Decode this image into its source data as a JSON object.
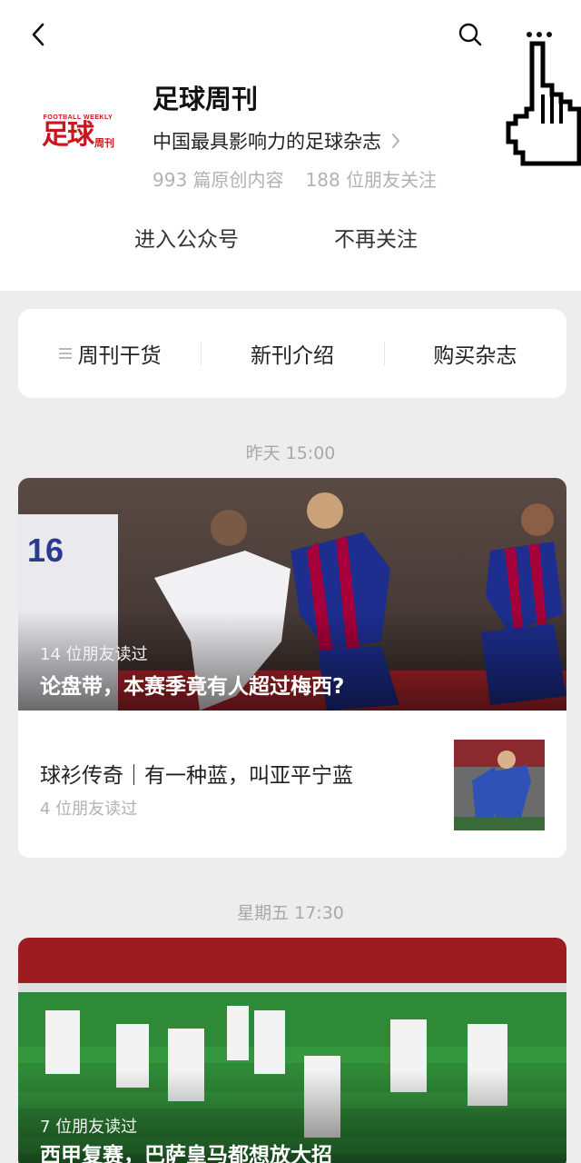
{
  "header": {
    "back_icon": "chevron-left-icon",
    "search_icon": "search-icon",
    "more_icon": "more-dots-icon"
  },
  "profile": {
    "logo_top": "FOOTBALL WEEKLY",
    "logo_main": "足球",
    "logo_small": "周刊",
    "name": "足球周刊",
    "description": "中国最具影响力的足球杂志",
    "original_count": "993 篇原创内容",
    "friends_following": "188 位朋友关注",
    "enter_label": "进入公众号",
    "unfollow_label": "不再关注"
  },
  "menu": {
    "items": [
      {
        "label": "周刊干货",
        "icon": "list-icon"
      },
      {
        "label": "新刊介绍"
      },
      {
        "label": "购买杂志"
      }
    ]
  },
  "feed": [
    {
      "time": "昨天 15:00",
      "main": {
        "readers": "14 位朋友读过",
        "title": "论盘带，本赛季竟有人超过梅西?"
      },
      "sub": {
        "title": "球衫传奇｜有一种蓝，叫亚平宁蓝",
        "readers": "4 位朋友读过"
      }
    },
    {
      "time": "星期五 17:30",
      "main": {
        "readers": "7 位朋友读过",
        "title": "西甲复赛，巴萨皇马都想放大招"
      }
    }
  ],
  "colors": {
    "brand_red": "#c8161d",
    "background": "#ededed",
    "secondary_text": "#b2b2b2"
  }
}
